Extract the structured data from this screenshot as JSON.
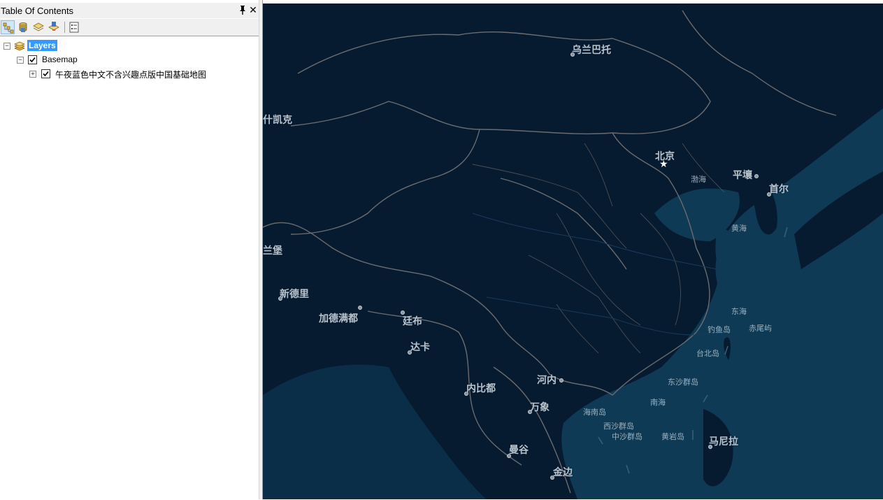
{
  "toc": {
    "title": "Table Of Contents",
    "pin_icon": "pin-icon",
    "close_icon": "close-icon",
    "toolbar": {
      "buttons": [
        "list-by-drawing-order-icon",
        "list-by-source-icon",
        "list-by-visibility-icon",
        "list-by-selection-icon",
        "options-icon"
      ]
    },
    "tree": {
      "root_label": "Layers",
      "group_label": "Basemap",
      "group_checked": true,
      "layer_label": "午夜蓝色中文不含兴趣点版中国基础地图",
      "layer_checked": true
    }
  },
  "map": {
    "background_color": "#061a30",
    "boundary_color": "#6b6c6f",
    "sea_color": "#0e3a55",
    "labels": {
      "ulaanbaatar": "乌兰巴托",
      "tashkent": "什凯克",
      "beijing": "北京",
      "bohai": "渤海",
      "pyongyang": "平壤",
      "seoul": "首尔",
      "yellow_sea": "黄海",
      "lanbao": "兰堡",
      "new_delhi": "新德里",
      "kathmandu": "加德满都",
      "thimphu": "廷布",
      "dhaka": "达卡",
      "east_sea": "东海",
      "diaoyu": "钓鱼岛",
      "chiwei": "赤尾屿",
      "taipei": "台北岛",
      "hanoi": "河内",
      "naypyidaw": "内比都",
      "dongsha": "东沙群岛",
      "vientiane": "万象",
      "south_sea": "南海",
      "hainan": "海南岛",
      "xisha": "西沙群岛",
      "zhongsha": "中沙群岛",
      "huangyan": "黄岩岛",
      "manila": "马尼拉",
      "bangkok": "曼谷",
      "phnom_penh": "金边"
    }
  }
}
